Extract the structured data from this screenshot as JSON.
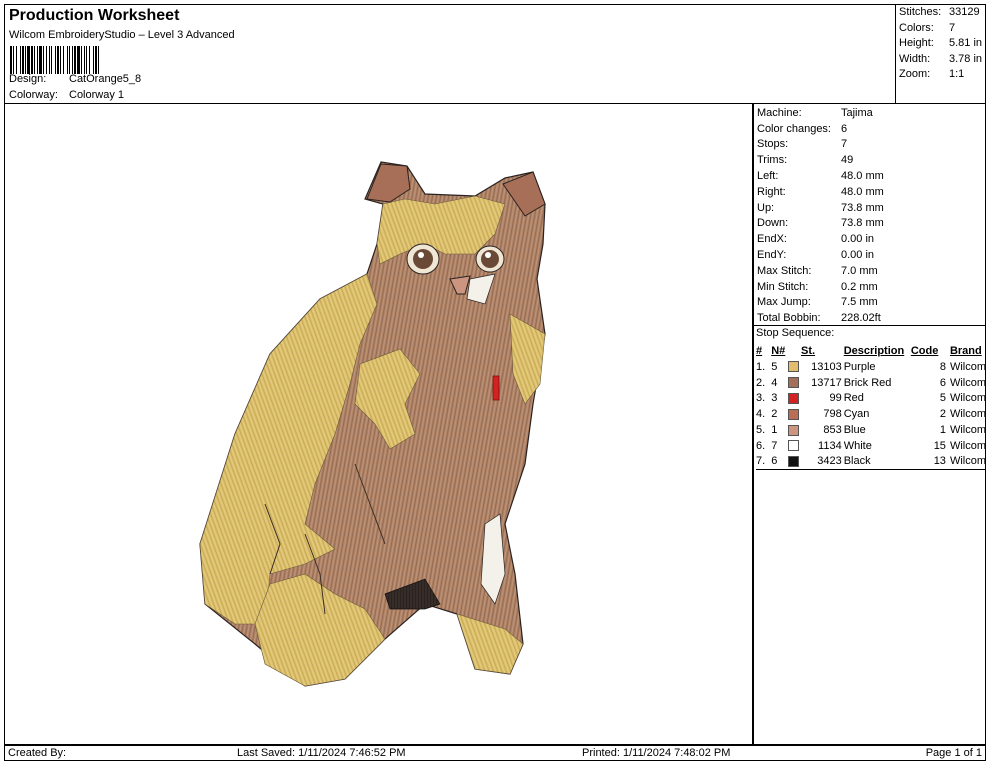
{
  "header": {
    "title": "Production Worksheet",
    "subtitle": "Wilcom EmbroideryStudio – Level 3 Advanced",
    "design_label": "Design:",
    "design_value": "CatOrange5_8",
    "colorway_label": "Colorway:",
    "colorway_value": "Colorway 1"
  },
  "summary": [
    {
      "label": "Stitches:",
      "value": "33129"
    },
    {
      "label": "Colors:",
      "value": "7"
    },
    {
      "label": "Height:",
      "value": "5.81 in"
    },
    {
      "label": "Width:",
      "value": "3.78 in"
    },
    {
      "label": "Zoom:",
      "value": "1:1"
    }
  ],
  "machine": [
    {
      "label": "Machine:",
      "value": "Tajima"
    },
    {
      "label": "Color changes:",
      "value": "6"
    },
    {
      "label": "Stops:",
      "value": "7"
    },
    {
      "label": "Trims:",
      "value": "49"
    },
    {
      "label": "Left:",
      "value": "48.0 mm"
    },
    {
      "label": "Right:",
      "value": "48.0 mm"
    },
    {
      "label": "Up:",
      "value": "73.8 mm"
    },
    {
      "label": "Down:",
      "value": "73.8 mm"
    },
    {
      "label": "EndX:",
      "value": "0.00 in"
    },
    {
      "label": "EndY:",
      "value": "0.00 in"
    },
    {
      "label": "Max Stitch:",
      "value": "7.0 mm"
    },
    {
      "label": "Min Stitch:",
      "value": "0.2 mm"
    },
    {
      "label": "Max Jump:",
      "value": "7.5 mm"
    },
    {
      "label": "Total Bobbin:",
      "value": "228.02ft"
    }
  ],
  "stop_sequence": {
    "title": "Stop Sequence:",
    "headers": {
      "idx": "#",
      "n": "N#",
      "st": "St.",
      "desc": "Description",
      "code": "Code",
      "brand": "Brand"
    },
    "rows": [
      {
        "idx": "1.",
        "n": "5",
        "color": "#e2bd6d",
        "st": "13103",
        "desc": "Purple",
        "code": "8",
        "brand": "Wilcom"
      },
      {
        "idx": "2.",
        "n": "4",
        "color": "#a46f5a",
        "st": "13717",
        "desc": "Brick Red",
        "code": "6",
        "brand": "Wilcom"
      },
      {
        "idx": "3.",
        "n": "3",
        "color": "#d42121",
        "st": "99",
        "desc": "Red",
        "code": "5",
        "brand": "Wilcom"
      },
      {
        "idx": "4.",
        "n": "2",
        "color": "#b96e55",
        "st": "798",
        "desc": "Cyan",
        "code": "2",
        "brand": "Wilcom"
      },
      {
        "idx": "5.",
        "n": "1",
        "color": "#cc957f",
        "st": "853",
        "desc": "Blue",
        "code": "1",
        "brand": "Wilcom"
      },
      {
        "idx": "6.",
        "n": "7",
        "color": "#ffffff",
        "st": "1134",
        "desc": "White",
        "code": "15",
        "brand": "Wilcom"
      },
      {
        "idx": "7.",
        "n": "6",
        "color": "#111111",
        "st": "3423",
        "desc": "Black",
        "code": "13",
        "brand": "Wilcom"
      }
    ]
  },
  "footer": {
    "created": "Created By:",
    "saved": "Last Saved: 1/11/2024 7:46:52 PM",
    "printed": "Printed: 1/11/2024 7:48:02 PM",
    "page": "Page 1 of 1"
  }
}
